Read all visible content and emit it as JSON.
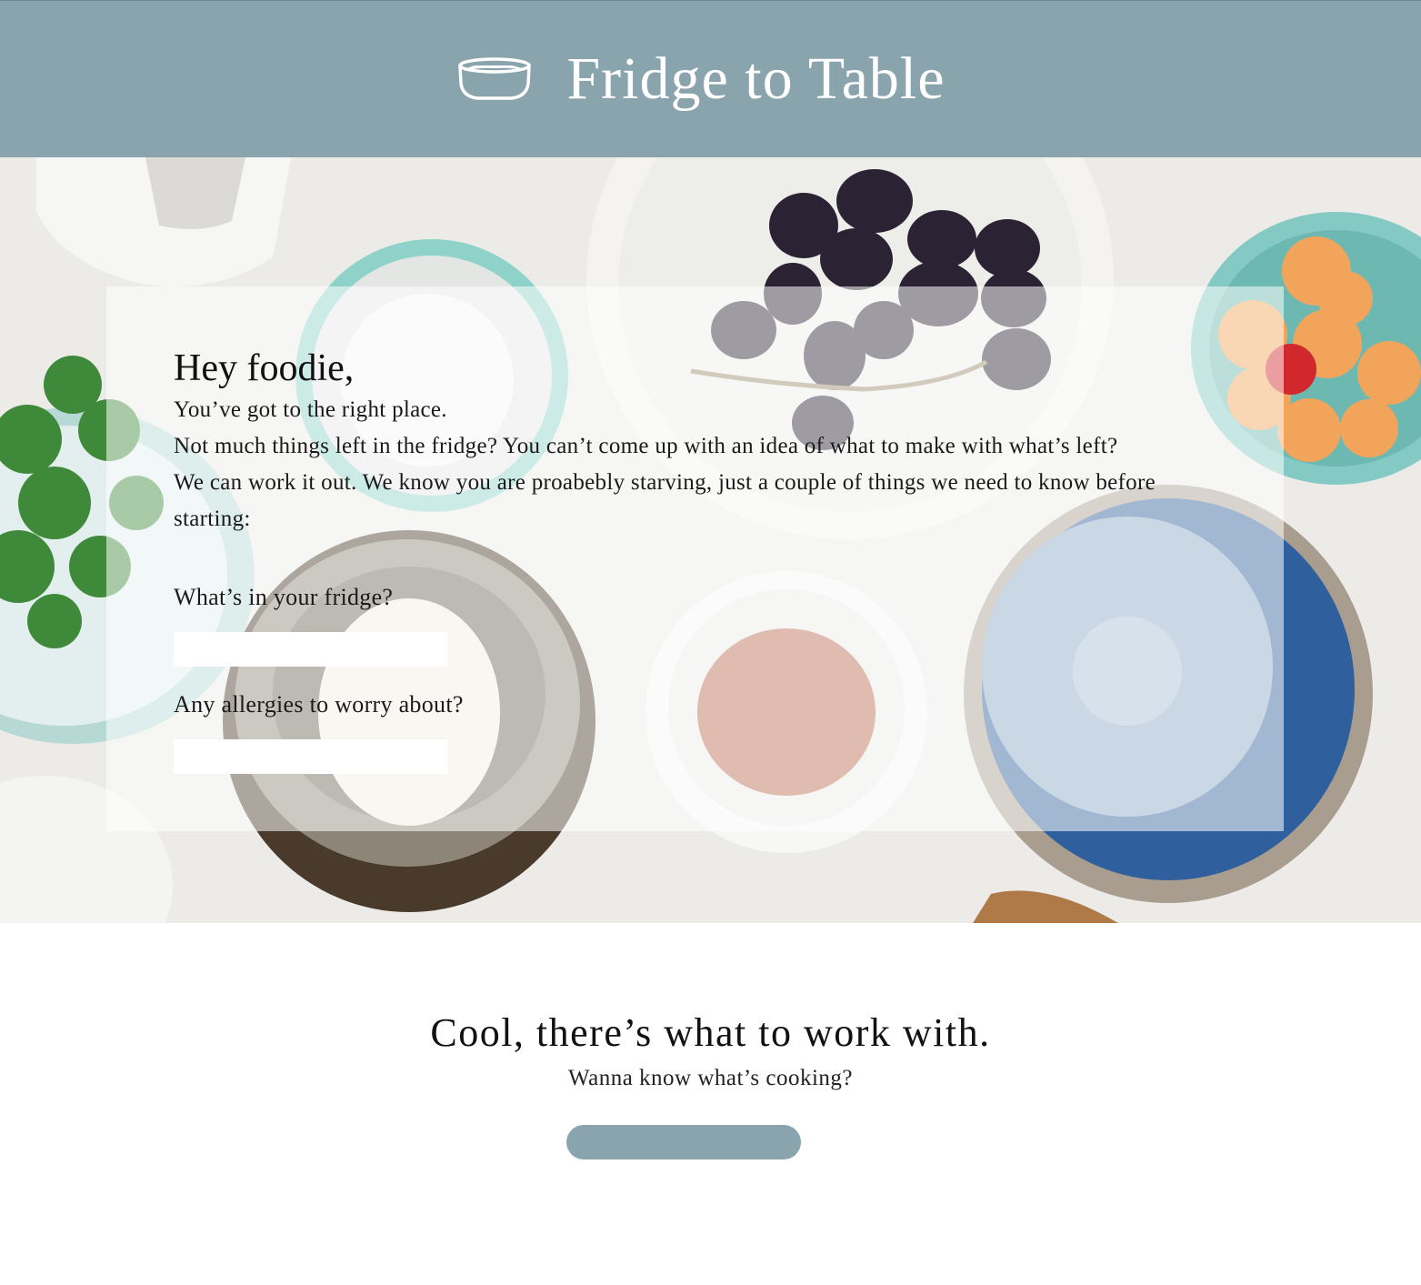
{
  "header": {
    "logo_icon": "bowl-icon",
    "title": "Fridge to Table",
    "bg_color": "#8aa4ad"
  },
  "hero": {
    "greeting": "Hey foodie,",
    "intro_lines": [
      "You’ve got to the right place.",
      "Not much things left in the fridge? You can’t come up with an idea of what to make with what’s left?",
      "We can work it out. We know you are proabebly starving, just a couple of things we need to know before starting:"
    ],
    "fridge_label": "What’s in your fridge?",
    "fridge_value": "",
    "allergies_label": "Any allergies to worry about?",
    "allergies_value": ""
  },
  "cta": {
    "title": "Cool, there’s what to work with.",
    "subtitle": "Wanna know what’s cooking?",
    "button_label": "",
    "button_color": "#8aa4ad"
  }
}
